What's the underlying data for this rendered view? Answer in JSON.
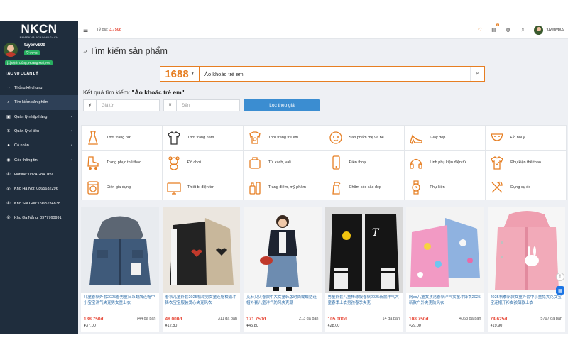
{
  "logo": {
    "text": "NKCN",
    "subtext": "NHAPKHAUCHINHNGACH"
  },
  "user": {
    "name": "tuyenvb09",
    "vip": "VIP 0",
    "address": "[1] Định Công, Hoàng Mai, HN"
  },
  "sidebar": {
    "section_title": "TÁC VỤ QUẢN LÝ",
    "items": [
      {
        "label": "Thống kê chung",
        "icon": "dashboard-icon",
        "has_chevron": false,
        "active": false
      },
      {
        "label": "Tìm kiếm sản phẩm",
        "icon": "search-icon",
        "has_chevron": false,
        "active": true
      },
      {
        "label": "Quản lý nhập hàng",
        "icon": "box-icon",
        "has_chevron": true,
        "active": false
      },
      {
        "label": "Quản lý ví tiền",
        "icon": "wallet-icon",
        "has_chevron": true,
        "active": false
      },
      {
        "label": "Cá nhân",
        "icon": "user-icon",
        "has_chevron": true,
        "active": false
      },
      {
        "label": "Góc thông tin",
        "icon": "info-icon",
        "has_chevron": true,
        "active": false
      },
      {
        "label": "Hotline: 0374.284.169",
        "icon": "phone-icon",
        "has_chevron": false,
        "active": false
      },
      {
        "label": "Kho Hà Nội: 0865632296",
        "icon": "phone-icon",
        "has_chevron": false,
        "active": false
      },
      {
        "label": "Kho Sài Gòn: 0965234838",
        "icon": "phone-icon",
        "has_chevron": false,
        "active": false
      },
      {
        "label": "Kho Đà Nẵng: 0977760991",
        "icon": "phone-icon",
        "has_chevron": false,
        "active": false
      }
    ]
  },
  "header": {
    "rate_label": "Tỷ giá:",
    "rate_value": "3.750đ",
    "cart_badge": "1",
    "username": "tuyenvb09"
  },
  "search": {
    "title": "Tìm kiếm sản phẩm",
    "platform": "1688",
    "query": "Áo khoác trẻ em",
    "result_label": "Kết quả tìm kiếm:",
    "result_query": "\"Áo khoác trẻ em\"",
    "currency_symbol": "¥",
    "price_from_placeholder": "Giá từ",
    "price_to_placeholder": "Đến",
    "filter_button": "Lọc theo giá"
  },
  "categories": [
    {
      "label": "Thời trang nữ",
      "icon": "dress-icon"
    },
    {
      "label": "Thời trang nam",
      "icon": "tshirt-icon"
    },
    {
      "label": "Thời trang trẻ em",
      "icon": "kids-clothes-icon"
    },
    {
      "label": "Sản phẩm mẹ và bé",
      "icon": "baby-icon"
    },
    {
      "label": "Giày dép",
      "icon": "high-heel-icon"
    },
    {
      "label": "Đồ nội y",
      "icon": "underwear-icon"
    },
    {
      "label": "Trang phục thể thao",
      "icon": "roller-skate-icon"
    },
    {
      "label": "Đồ chơi",
      "icon": "teddy-bear-icon"
    },
    {
      "label": "Túi xách, vali",
      "icon": "suitcase-icon"
    },
    {
      "label": "Điện thoại",
      "icon": "phone-device-icon"
    },
    {
      "label": "Linh phụ kiện điện tử",
      "icon": "headphones-icon"
    },
    {
      "label": "Phụ kiện thể thao",
      "icon": "sport-shirt-icon"
    },
    {
      "label": "Điện gia dụng",
      "icon": "washing-machine-icon"
    },
    {
      "label": "Thiết bị điện tử",
      "icon": "tv-icon"
    },
    {
      "label": "Trang điểm, mỹ phẩm",
      "icon": "cosmetics-icon"
    },
    {
      "label": "Chăm sóc sắc đẹp",
      "icon": "spray-bottle-icon"
    },
    {
      "label": "Phụ kiện",
      "icon": "watch-icon"
    },
    {
      "label": "Dụng cụ đo",
      "icon": "tools-icon"
    }
  ],
  "products": [
    {
      "title": "儿童春秋外套2025春男童日系翻牌连帽中小宝宝洋气夹克男女童上衣",
      "price": "138.750đ",
      "sold": "744 đã bán",
      "cny": "¥37.00"
    },
    {
      "title": "春秋儿童外套2025秋款男女童连帽校铁冲锋衣宝宝服装爱心夹克风衣",
      "price": "48.000đ",
      "sold": "311 đã bán",
      "cny": "¥12.80"
    },
    {
      "title": "艾麻贝贝春款中大女童韩版时尚蝴蝶结连帽外套儿童洋气防风夹克潮",
      "price": "171.750đ",
      "sold": "213 đã bán",
      "cny": "¥45.80"
    },
    {
      "title": "男童外套儿童棒球服春秋2025新款洋气大童春季上衣男孩春季夹克",
      "price": "105.000đ",
      "sold": "14 đã bán",
      "cny": "¥28.00"
    },
    {
      "title": "网eo儿童女孩落春秋洋气女童冲锋衣2025新款户外夹克防风衣",
      "price": "108.750đ",
      "sold": "4063 đã bán",
      "cny": "¥29.00"
    },
    {
      "title": "2025秋季新款女童外套中小童兔夹克女宝宝连帽开衫女孩薄款上衣",
      "price": "74.625đ",
      "sold": "5797 đã bán",
      "cny": "¥19.90"
    }
  ],
  "colors": {
    "sidebar_bg": "#1f2d3d",
    "accent_orange": "#e67e22",
    "price_red": "#e74c3c",
    "link_blue": "#2f6ea8",
    "button_blue": "#3b8dd1",
    "vip_green": "#27ae60"
  }
}
